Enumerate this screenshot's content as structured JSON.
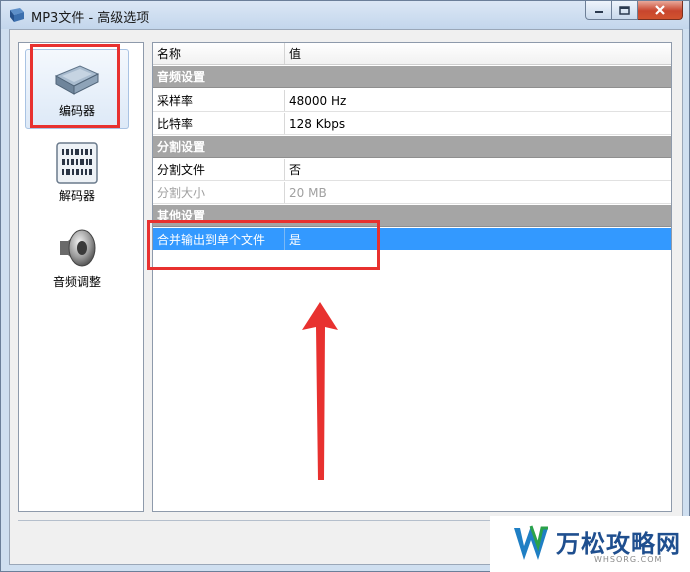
{
  "window": {
    "title": "MP3文件 - 高级选项",
    "buttons": {
      "minimize": "minimize-icon",
      "maximize": "maximize-icon",
      "close": "close-icon"
    }
  },
  "sidebar": {
    "items": [
      {
        "label": "编码器",
        "icon": "encoder-box-icon",
        "selected": true
      },
      {
        "label": "解码器",
        "icon": "decoder-barcode-icon",
        "selected": false
      },
      {
        "label": "音频调整",
        "icon": "speaker-icon",
        "selected": false
      }
    ]
  },
  "grid": {
    "headers": {
      "name": "名称",
      "value": "值"
    },
    "categories": {
      "audio": "音频设置",
      "split": "分割设置",
      "other": "其他设置"
    },
    "rows": [
      {
        "name": "采样率",
        "value": "48000 Hz"
      },
      {
        "name": "比特率",
        "value": "128 Kbps"
      },
      {
        "name": "分割文件",
        "value": "否"
      },
      {
        "name": "分割大小",
        "value": "20 MB",
        "disabled": true
      },
      {
        "name": "合并输出到单个文件",
        "value": "是",
        "selected": true
      }
    ]
  },
  "colors": {
    "accent": "#3399ff",
    "annotation": "#e8312f",
    "category_bg": "#a5a5a5"
  },
  "watermark": {
    "text": "万松攻略网",
    "sub": "WHSORG.COM"
  }
}
